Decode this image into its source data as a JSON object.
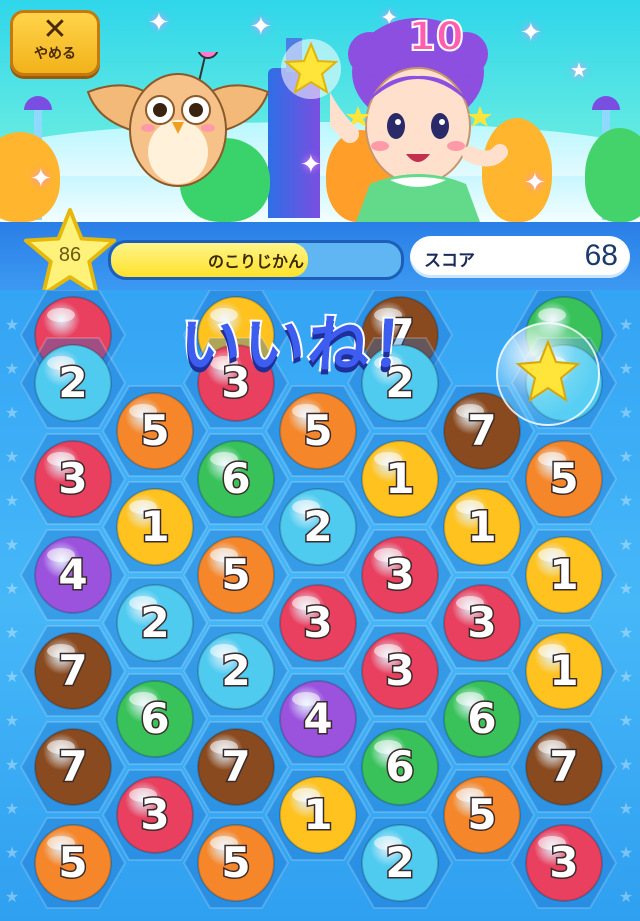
{
  "header": {
    "quit_icon": "✕",
    "quit_label": "やめる"
  },
  "character": {
    "hair_number": "10"
  },
  "status": {
    "time_value": "86",
    "time_label": "のこりじかん",
    "time_remaining_fraction": 0.68,
    "score_label": "スコア",
    "score_value": "68"
  },
  "popup": {
    "message": "いいね！"
  },
  "colors": {
    "red": "#e8405e",
    "orange": "#f5862a",
    "green": "#39c25a",
    "cyan": "#4fcbf0",
    "brown": "#8a4a1f",
    "yellow": "#ffc21e",
    "purple": "#9b53de"
  },
  "board": {
    "rows": [
      [
        {
          "v": "",
          "c": "red"
        },
        {
          "v": "",
          "c": "yellow"
        },
        {
          "v": "7",
          "c": "brown"
        },
        {
          "v": "",
          "c": "green"
        }
      ],
      [
        {
          "v": "2",
          "c": "cyan"
        },
        {
          "v": "3",
          "c": "red"
        },
        {
          "v": "2",
          "c": "cyan"
        },
        {
          "v": "",
          "c": "cyan"
        }
      ],
      [
        {
          "v": "5",
          "c": "orange"
        },
        {
          "v": "5",
          "c": "orange"
        },
        {
          "v": "7",
          "c": "brown"
        }
      ],
      [
        {
          "v": "3",
          "c": "red"
        },
        {
          "v": "6",
          "c": "green"
        },
        {
          "v": "1",
          "c": "yellow"
        },
        {
          "v": "5",
          "c": "orange"
        }
      ],
      [
        {
          "v": "1",
          "c": "yellow"
        },
        {
          "v": "2",
          "c": "cyan"
        },
        {
          "v": "1",
          "c": "yellow"
        }
      ],
      [
        {
          "v": "4",
          "c": "purple"
        },
        {
          "v": "5",
          "c": "orange"
        },
        {
          "v": "3",
          "c": "red"
        },
        {
          "v": "1",
          "c": "yellow"
        }
      ],
      [
        {
          "v": "2",
          "c": "cyan"
        },
        {
          "v": "3",
          "c": "red"
        },
        {
          "v": "3",
          "c": "red"
        }
      ],
      [
        {
          "v": "7",
          "c": "brown"
        },
        {
          "v": "2",
          "c": "cyan"
        },
        {
          "v": "3",
          "c": "red"
        },
        {
          "v": "1",
          "c": "yellow"
        }
      ],
      [
        {
          "v": "6",
          "c": "green"
        },
        {
          "v": "4",
          "c": "purple"
        },
        {
          "v": "6",
          "c": "green"
        }
      ],
      [
        {
          "v": "7",
          "c": "brown"
        },
        {
          "v": "7",
          "c": "brown"
        },
        {
          "v": "6",
          "c": "green"
        },
        {
          "v": "7",
          "c": "brown"
        }
      ],
      [
        {
          "v": "3",
          "c": "red"
        },
        {
          "v": "1",
          "c": "yellow"
        },
        {
          "v": "5",
          "c": "orange"
        }
      ],
      [
        {
          "v": "5",
          "c": "orange"
        },
        {
          "v": "5",
          "c": "orange"
        },
        {
          "v": "2",
          "c": "cyan"
        },
        {
          "v": "3",
          "c": "red"
        }
      ]
    ]
  }
}
